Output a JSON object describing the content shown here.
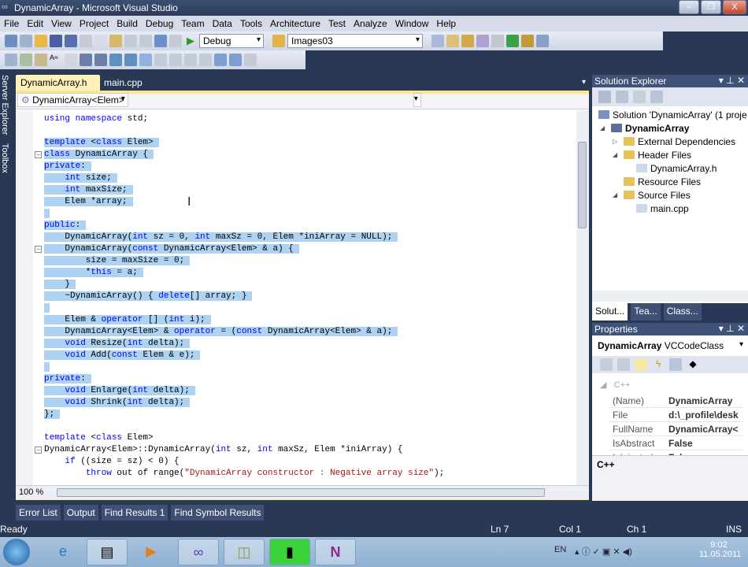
{
  "window": {
    "title": "DynamicArray - Microsoft Visual Studio",
    "minimize": "–",
    "restore": "❐",
    "close": "X"
  },
  "menu": [
    "File",
    "Edit",
    "View",
    "Project",
    "Build",
    "Debug",
    "Team",
    "Data",
    "Tools",
    "Architecture",
    "Test",
    "Analyze",
    "Window",
    "Help"
  ],
  "toolbar": {
    "config": "Debug",
    "search": "Images03"
  },
  "sidebar_left": [
    "Server Explorer",
    "Toolbox"
  ],
  "tabs": [
    {
      "label": "DynamicArray.h",
      "active": true,
      "close": "×"
    },
    {
      "label": "main.cpp",
      "active": false
    }
  ],
  "editor": {
    "class_combo": "DynamicArray<Elem>",
    "member_combo": "",
    "zoom": "100 %",
    "lines": [
      {
        "segs": [
          [
            "using",
            "kw"
          ],
          [
            " ",
            "pl"
          ],
          [
            "namespace",
            "kw"
          ],
          [
            " std;",
            "pl"
          ]
        ],
        "sel": false
      },
      {
        "segs": [],
        "sel": false
      },
      {
        "segs": [
          [
            "template",
            "kw"
          ],
          [
            " <",
            "pl"
          ],
          [
            "class",
            "kw"
          ],
          [
            " Elem>",
            "pl"
          ]
        ],
        "sel": true
      },
      {
        "segs": [
          [
            "class",
            "kw"
          ],
          [
            " DynamicArray {",
            "pl"
          ]
        ],
        "sel": true,
        "fold": true
      },
      {
        "segs": [
          [
            "private",
            "kw"
          ],
          [
            ":",
            "pl"
          ]
        ],
        "sel": true
      },
      {
        "segs": [
          [
            "    ",
            "pl"
          ],
          [
            "int",
            "kw"
          ],
          [
            " size;",
            "pl"
          ]
        ],
        "sel": true
      },
      {
        "segs": [
          [
            "    ",
            "pl"
          ],
          [
            "int",
            "kw"
          ],
          [
            " maxSize;",
            "pl"
          ]
        ],
        "sel": true
      },
      {
        "segs": [
          [
            "    Elem *array;",
            "pl"
          ]
        ],
        "sel": true
      },
      {
        "segs": [
          [
            "",
            "pl"
          ]
        ],
        "sel": true
      },
      {
        "segs": [
          [
            "public",
            "kw"
          ],
          [
            ":",
            "pl"
          ]
        ],
        "sel": true
      },
      {
        "segs": [
          [
            "    DynamicArray(",
            "pl"
          ],
          [
            "int",
            "kw"
          ],
          [
            " sz = 0, ",
            "pl"
          ],
          [
            "int",
            "kw"
          ],
          [
            " maxSz = 0, Elem *iniArray = NULL);",
            "pl"
          ]
        ],
        "sel": true
      },
      {
        "segs": [
          [
            "    DynamicArray(",
            "pl"
          ],
          [
            "const",
            "kw"
          ],
          [
            " DynamicArray<Elem> & a) {",
            "pl"
          ]
        ],
        "sel": true,
        "fold": true
      },
      {
        "segs": [
          [
            "        size = maxSize = 0;",
            "pl"
          ]
        ],
        "sel": true
      },
      {
        "segs": [
          [
            "        *",
            "pl"
          ],
          [
            "this",
            "kw"
          ],
          [
            " = a;",
            "pl"
          ]
        ],
        "sel": true
      },
      {
        "segs": [
          [
            "    }",
            "pl"
          ]
        ],
        "sel": true
      },
      {
        "segs": [
          [
            "    ~DynamicArray() { ",
            "pl"
          ],
          [
            "delete",
            "kw"
          ],
          [
            "[] array; }",
            "pl"
          ]
        ],
        "sel": true
      },
      {
        "segs": [
          [
            "",
            "pl"
          ]
        ],
        "sel": true
      },
      {
        "segs": [
          [
            "    Elem & ",
            "pl"
          ],
          [
            "operator",
            "kw"
          ],
          [
            " [] (",
            "pl"
          ],
          [
            "int",
            "kw"
          ],
          [
            " i);",
            "pl"
          ]
        ],
        "sel": true
      },
      {
        "segs": [
          [
            "    DynamicArray<Elem> & ",
            "pl"
          ],
          [
            "operator",
            "kw"
          ],
          [
            " = (",
            "pl"
          ],
          [
            "const",
            "kw"
          ],
          [
            " DynamicArray<Elem> & a);",
            "pl"
          ]
        ],
        "sel": true
      },
      {
        "segs": [
          [
            "    ",
            "pl"
          ],
          [
            "void",
            "kw"
          ],
          [
            " Resize(",
            "pl"
          ],
          [
            "int",
            "kw"
          ],
          [
            " delta);",
            "pl"
          ]
        ],
        "sel": true
      },
      {
        "segs": [
          [
            "    ",
            "pl"
          ],
          [
            "void",
            "kw"
          ],
          [
            " Add(",
            "pl"
          ],
          [
            "const",
            "kw"
          ],
          [
            " Elem & e);",
            "pl"
          ]
        ],
        "sel": true
      },
      {
        "segs": [
          [
            "",
            "pl"
          ]
        ],
        "sel": true
      },
      {
        "segs": [
          [
            "private",
            "kw"
          ],
          [
            ":",
            "pl"
          ]
        ],
        "sel": true
      },
      {
        "segs": [
          [
            "    ",
            "pl"
          ],
          [
            "void",
            "kw"
          ],
          [
            " Enlarge(",
            "pl"
          ],
          [
            "int",
            "kw"
          ],
          [
            " delta);",
            "pl"
          ]
        ],
        "sel": true
      },
      {
        "segs": [
          [
            "    ",
            "pl"
          ],
          [
            "void",
            "kw"
          ],
          [
            " Shrink(",
            "pl"
          ],
          [
            "int",
            "kw"
          ],
          [
            " delta);",
            "pl"
          ]
        ],
        "sel": true
      },
      {
        "segs": [
          [
            "};",
            "pl"
          ]
        ],
        "sel": true
      },
      {
        "segs": [],
        "sel": false
      },
      {
        "segs": [
          [
            "template",
            "kw"
          ],
          [
            " <",
            "pl"
          ],
          [
            "class",
            "kw"
          ],
          [
            " Elem>",
            "pl"
          ]
        ],
        "sel": false
      },
      {
        "segs": [
          [
            "DynamicArray<Elem>::DynamicArray(",
            "pl"
          ],
          [
            "int",
            "kw"
          ],
          [
            " sz, ",
            "pl"
          ],
          [
            "int",
            "kw"
          ],
          [
            " maxSz, Elem *iniArray) {",
            "pl"
          ]
        ],
        "sel": false,
        "fold": true
      },
      {
        "segs": [
          [
            "    ",
            "pl"
          ],
          [
            "if",
            "kw"
          ],
          [
            " ((size = sz) < 0) {",
            "pl"
          ]
        ],
        "sel": false
      },
      {
        "segs": [
          [
            "        ",
            "pl"
          ],
          [
            "throw",
            "kw"
          ],
          [
            " out of range(",
            "pl"
          ],
          [
            "\"DynamicArray constructor : Negative array size\"",
            "str"
          ],
          [
            ");",
            "pl"
          ]
        ],
        "sel": false
      }
    ]
  },
  "solution_explorer": {
    "title": "Solution Explorer",
    "items": [
      {
        "label": "Solution 'DynamicArray' (1 proje",
        "depth": 0,
        "icon": "solution-icon"
      },
      {
        "label": "DynamicArray",
        "depth": 1,
        "bold": true,
        "expander": "◢",
        "icon": "project-icon"
      },
      {
        "label": "External Dependencies",
        "depth": 2,
        "expander": "▷",
        "icon": "folder-icon"
      },
      {
        "label": "Header Files",
        "depth": 2,
        "expander": "◢",
        "icon": "folder-open-icon"
      },
      {
        "label": "DynamicArray.h",
        "depth": 3,
        "icon": "header-file-icon"
      },
      {
        "label": "Resource Files",
        "depth": 2,
        "icon": "folder-icon"
      },
      {
        "label": "Source Files",
        "depth": 2,
        "expander": "◢",
        "icon": "folder-open-icon"
      },
      {
        "label": "main.cpp",
        "depth": 3,
        "icon": "cpp-file-icon"
      }
    ],
    "tabs": [
      "Solut...",
      "Tea...",
      "Class..."
    ]
  },
  "properties": {
    "title": "Properties",
    "object": "DynamicArray",
    "type": "VCCodeClass",
    "category": "C++",
    "rows": [
      {
        "k": "(Name)",
        "v": "DynamicArray"
      },
      {
        "k": "File",
        "v": "d:\\_profile\\desk"
      },
      {
        "k": "FullName",
        "v": "DynamicArray<"
      },
      {
        "k": "IsAbstract",
        "v": "False"
      },
      {
        "k": "IsInjected",
        "v": "False"
      }
    ],
    "description": "C++"
  },
  "bottom_tabs": [
    "Error List",
    "Output",
    "Find Results 1",
    "Find Symbol Results"
  ],
  "status": {
    "text": "Ready",
    "ln": "Ln 7",
    "col": "Col 1",
    "ch": "Ch 1",
    "mode": "INS"
  },
  "taskbar": {
    "lang": "EN",
    "time": "9:02",
    "date": "11.05.2011"
  },
  "colors": {
    "chrome": "#293955",
    "selection": "#add2f2",
    "keyword": "#0000ff",
    "string": "#a31515",
    "active_tab": "#fff1b8"
  }
}
